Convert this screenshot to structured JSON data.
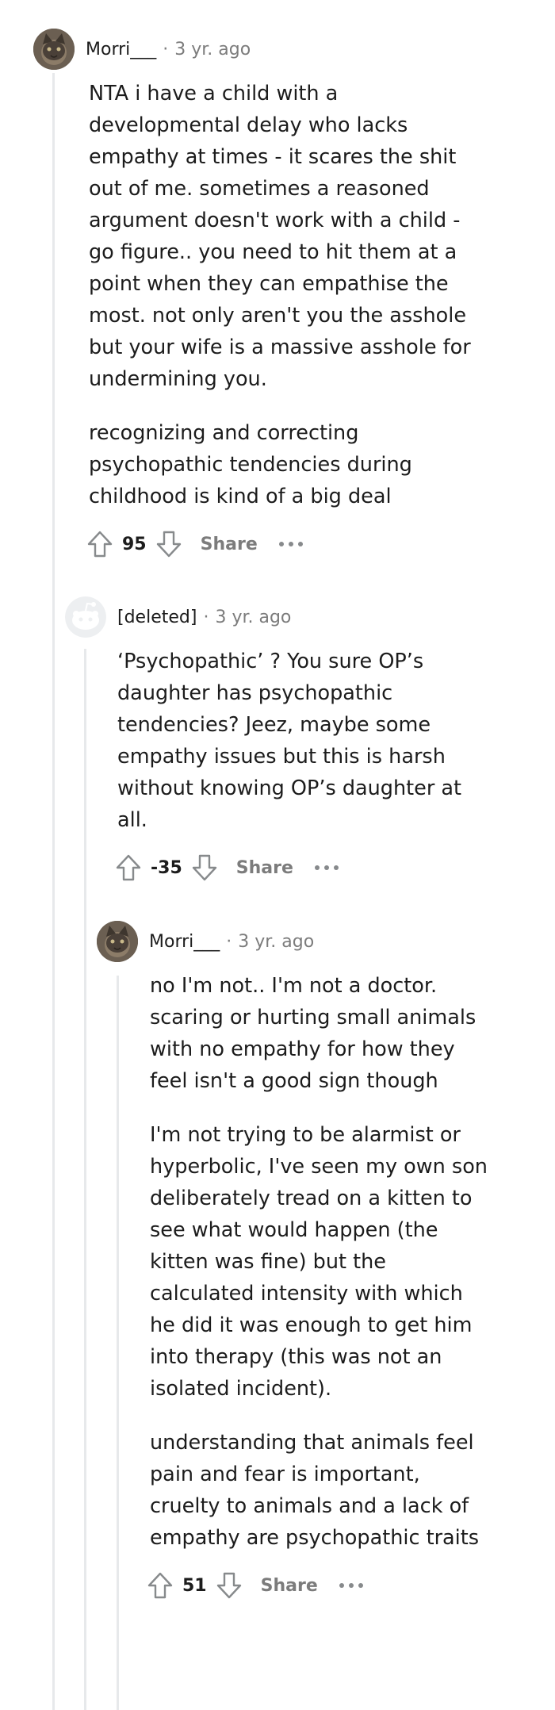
{
  "comments": [
    {
      "username": "Morri___",
      "separator": "·",
      "time": "3 yr. ago",
      "paragraphs": [
        "NTA i have a child with a developmental delay who lacks empathy at times - it scares the shit out of me. sometimes a reasoned argument doesn't work with a child - go figure.. you need to hit them at a point when they can empathise the most. not only aren't you the asshole but your wife is a massive asshole for undermining you.",
        "recognizing and correcting psychopathic tendencies during childhood is kind of a big deal"
      ],
      "score": "95",
      "share_label": "Share"
    },
    {
      "username": "[deleted]",
      "separator": "·",
      "time": "3 yr. ago",
      "paragraphs": [
        "‘Psychopathic’ ? You sure OP’s daughter has psychopathic tendencies? Jeez, maybe some empathy issues but this is harsh without knowing OP’s daughter at all."
      ],
      "score": "-35",
      "share_label": "Share"
    },
    {
      "username": "Morri___",
      "separator": "·",
      "time": "3 yr. ago",
      "paragraphs": [
        "no I'm not.. I'm not a doctor. scaring or hurting small animals with no empathy for how they feel isn't a good sign though",
        "I'm not trying to be alarmist or hyperbolic, I've seen my own son deliberately tread on a kitten to see what would happen (the kitten was fine) but the calculated intensity with which he did it was enough to get him into therapy (this was not an isolated incident).",
        "understanding that animals feel pain and fear is important, cruelty to animals and a lack of empathy are psychopathic traits"
      ],
      "score": "51",
      "share_label": "Share"
    }
  ],
  "icons": {
    "upvote": "upvote-arrow-icon",
    "downvote": "downvote-arrow-icon",
    "more": "more-options-icon",
    "avatar_cat": "cat-avatar",
    "avatar_deleted": "deleted-user-avatar"
  },
  "colors": {
    "text": "#1c1c1c",
    "meta": "#7c7c7c",
    "thread_line": "#e7e9eb",
    "icon": "#878a8c"
  }
}
